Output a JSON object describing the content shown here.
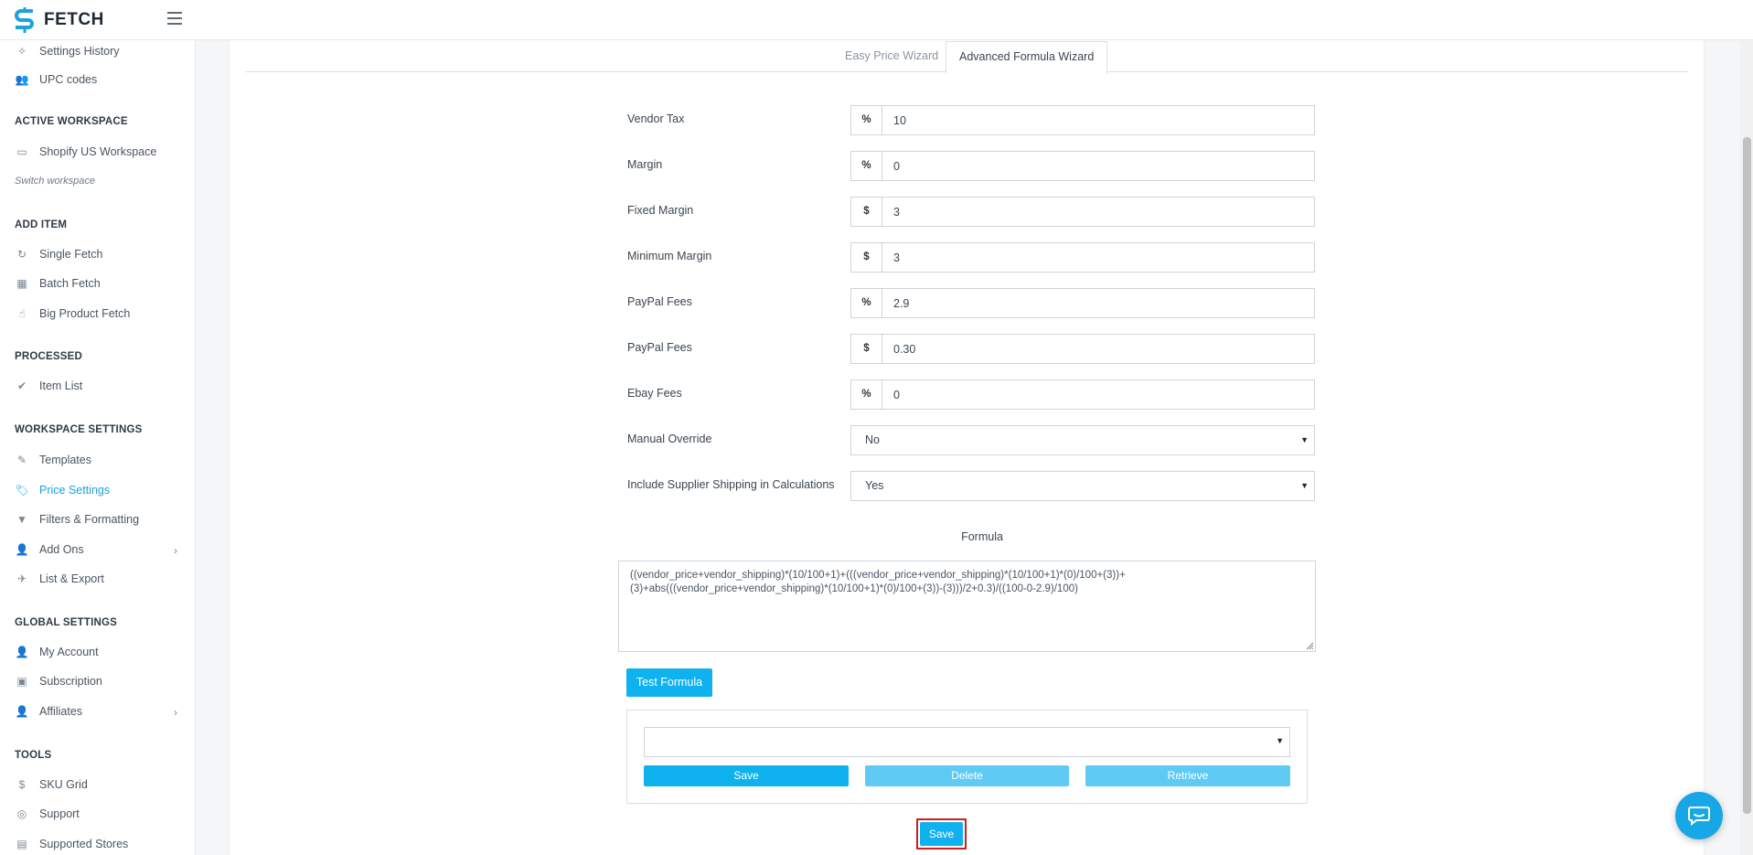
{
  "app": {
    "name": "FETCH"
  },
  "sidebar": {
    "top_items": [
      {
        "label": "Settings History",
        "icon": "magic-wand-icon"
      },
      {
        "label": "UPC codes",
        "icon": "users-icon"
      }
    ],
    "sections": {
      "active_workspace": "ACTIVE WORKSPACE",
      "add_item": "ADD ITEM",
      "processed": "PROCESSED",
      "workspace_settings": "WORKSPACE SETTINGS",
      "global_settings": "GLOBAL SETTINGS",
      "tools": "TOOLS"
    },
    "workspace": {
      "label": "Shopify US Workspace",
      "switch": "Switch workspace"
    },
    "add_item": [
      "Single Fetch",
      "Batch Fetch",
      "Big Product Fetch"
    ],
    "processed": [
      "Item List"
    ],
    "workspace_settings": [
      "Templates",
      "Price Settings",
      "Filters & Formatting",
      "Add Ons",
      "List & Export"
    ],
    "global_settings": [
      "My Account",
      "Subscription",
      "Affiliates"
    ],
    "tools": [
      "SKU Grid",
      "Support",
      "Supported Stores"
    ],
    "active_item": "Price Settings"
  },
  "tabs": [
    {
      "label": "Easy Price Wizard",
      "active": false
    },
    {
      "label": "Advanced Formula Wizard",
      "active": true
    }
  ],
  "fields": [
    {
      "label": "Vendor Tax",
      "addon": "%",
      "value": "10"
    },
    {
      "label": "Margin",
      "addon": "%",
      "value": "0"
    },
    {
      "label": "Fixed Margin",
      "addon": "$",
      "value": "3"
    },
    {
      "label": "Minimum Margin",
      "addon": "$",
      "value": "3"
    },
    {
      "label": "PayPal Fees",
      "addon": "%",
      "value": "2.9"
    },
    {
      "label": "PayPal Fees",
      "addon": "$",
      "value": "0.30"
    },
    {
      "label": "Ebay Fees",
      "addon": "%",
      "value": "0"
    }
  ],
  "selects": [
    {
      "label": "Manual Override",
      "value": "No"
    },
    {
      "label": "Include Supplier Shipping in Calculations",
      "value": "Yes"
    }
  ],
  "formula": {
    "title": "Formula",
    "line1": "((vendor_price+vendor_shipping)*(10/100+1)+(((vendor_price+vendor_shipping)*(10/100+1)*(0)/100+(3))+",
    "line2": "(3)+abs(((vendor_price+vendor_shipping)*(10/100+1)*(0)/100+(3))-(3)))/2+0.3)/((100-0-2.9)/100)"
  },
  "buttons": {
    "test_formula": "Test Formula",
    "save_formula": "Save",
    "delete_formula": "Delete",
    "retrieve_formula": "Retrieve",
    "save_main": "Save"
  },
  "saved_select": {
    "value": ""
  },
  "colors": {
    "accent": "#0fb2ef",
    "accent_light": "#5fcaf3",
    "highlight_border": "#cc1f1f"
  }
}
